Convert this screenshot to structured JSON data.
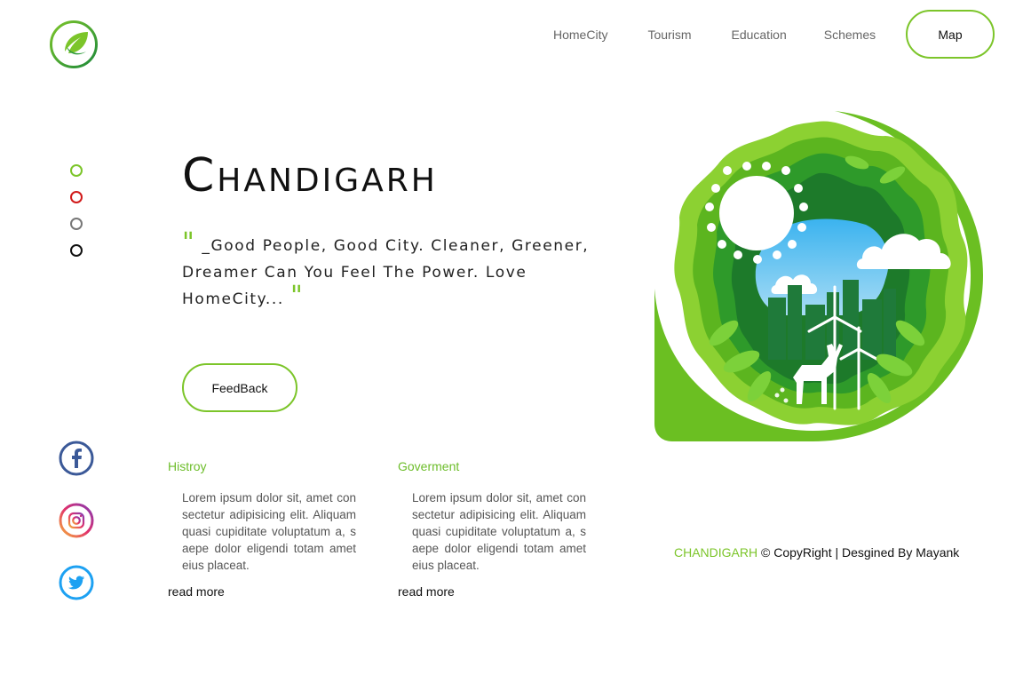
{
  "header": {
    "logo": {
      "icon": "leaf-logo-icon"
    },
    "nav": [
      "HomeCity",
      "Tourism",
      "Education",
      "Schemes"
    ],
    "map_label": "Map"
  },
  "slider": {
    "dots": [
      {
        "icon": "slide-dot",
        "color": "#7cc52a"
      },
      {
        "icon": "slide-dot",
        "color": "#d11a1a"
      },
      {
        "icon": "slide-dot",
        "color": "#777777"
      },
      {
        "icon": "slide-dot",
        "color": "#111111"
      }
    ]
  },
  "hero": {
    "title": "Chandigarh",
    "quote_open": "\"",
    "quote_text": "_Good People, Good City. Cleaner, Greener, Dreamer Can You Feel The Power. Love HomeCity...",
    "quote_close": "\"",
    "feedback_label": "FeedBack"
  },
  "social": [
    {
      "icon": "facebook-icon"
    },
    {
      "icon": "instagram-icon"
    },
    {
      "icon": "twitter-icon"
    }
  ],
  "cards": [
    {
      "title": "Histroy",
      "text": "Lorem ipsum dolor sit, amet consectetur adipisicing elit. Aliquam quasi cupiditate voluptatum a, saepe dolor eligendi totam amet eius placeat.",
      "more": "read more"
    },
    {
      "title": "Goverment",
      "text": "Lorem ipsum dolor sit, amet consectetur adipisicing elit. Aliquam quasi cupiditate voluptatum a, saepe dolor eligendi totam amet eius placeat.",
      "more": "read more"
    }
  ],
  "illustration": {
    "icon": "green-city-illustration"
  },
  "footer": {
    "brand": "CHANDIGARH",
    "rest": "© CopyRight | Desgined By Mayank"
  },
  "colors": {
    "accent": "#7cc52a",
    "dark_green": "#2e8b2e"
  }
}
